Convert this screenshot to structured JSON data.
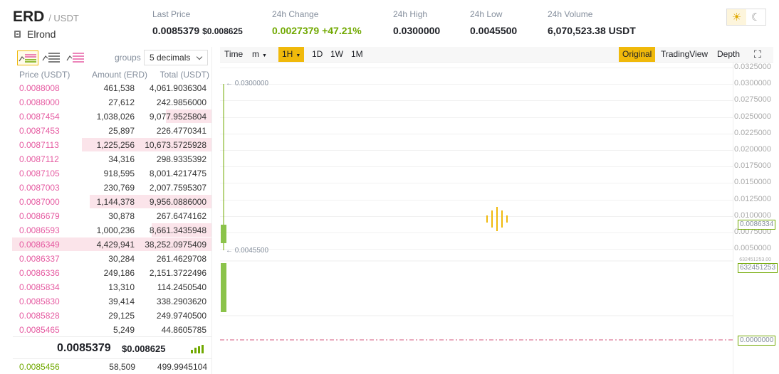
{
  "header": {
    "symbol": "ERD",
    "quote": "/ USDT",
    "coin_name": "Elrond",
    "last_price_label": "Last Price",
    "last_price": "0.0085379",
    "last_price_usd": "$0.008625",
    "change_label": "24h Change",
    "change_value": "0.0027379",
    "change_pct": "+47.21%",
    "high_label": "24h High",
    "high_value": "0.0300000",
    "low_label": "24h Low",
    "low_value": "0.0045500",
    "volume_label": "24h Volume",
    "volume_value": "6,070,523.38 USDT",
    "theme_icons": [
      "sun-icon",
      "moon-icon"
    ]
  },
  "orderbook": {
    "groups_label": "groups",
    "groups_value": "5 decimals",
    "col_price": "Price (USDT)",
    "col_amount": "Amount (ERD)",
    "col_total": "Total (USDT)",
    "asks": [
      {
        "price": "0.0088008",
        "amount": "461,538",
        "total": "4,061.9036304",
        "depth": 0
      },
      {
        "price": "0.0088000",
        "amount": "27,612",
        "total": "242.9856000",
        "depth": 0
      },
      {
        "price": "0.0087454",
        "amount": "1,038,026",
        "total": "9,077.9525804",
        "depth": 0.23
      },
      {
        "price": "0.0087453",
        "amount": "25,897",
        "total": "226.4770341",
        "depth": 0
      },
      {
        "price": "0.0087113",
        "amount": "1,225,256",
        "total": "10,673.5725928",
        "depth": 0.65
      },
      {
        "price": "0.0087112",
        "amount": "34,316",
        "total": "298.9335392",
        "depth": 0
      },
      {
        "price": "0.0087105",
        "amount": "918,595",
        "total": "8,001.4217475",
        "depth": 0
      },
      {
        "price": "0.0087003",
        "amount": "230,769",
        "total": "2,007.7595307",
        "depth": 0
      },
      {
        "price": "0.0087000",
        "amount": "1,144,378",
        "total": "9,956.0886000",
        "depth": 0.61
      },
      {
        "price": "0.0086679",
        "amount": "30,878",
        "total": "267.6474162",
        "depth": 0
      },
      {
        "price": "0.0086593",
        "amount": "1,000,236",
        "total": "8,661.3435948",
        "depth": 0.3
      },
      {
        "price": "0.0086349",
        "amount": "4,429,941",
        "total": "38,252.0975409",
        "depth": 1.0
      },
      {
        "price": "0.0086337",
        "amount": "30,284",
        "total": "261.4629708",
        "depth": 0
      },
      {
        "price": "0.0086336",
        "amount": "249,186",
        "total": "2,151.3722496",
        "depth": 0
      },
      {
        "price": "0.0085834",
        "amount": "13,310",
        "total": "114.2450540",
        "depth": 0
      },
      {
        "price": "0.0085830",
        "amount": "39,414",
        "total": "338.2903620",
        "depth": 0
      },
      {
        "price": "0.0085828",
        "amount": "29,125",
        "total": "249.9740500",
        "depth": 0
      },
      {
        "price": "0.0085465",
        "amount": "5,249",
        "total": "44.8605785",
        "depth": 0
      }
    ],
    "last_price": "0.0085379",
    "last_price_usd": "$0.008625",
    "bids": [
      {
        "price": "0.0085456",
        "amount": "58,509",
        "total": "499.9945104"
      }
    ]
  },
  "chart": {
    "toolbar": [
      "Time",
      "m",
      "1H",
      "1D",
      "1W",
      "1M"
    ],
    "active": "1H",
    "views": [
      "Original",
      "TradingView",
      "Depth"
    ],
    "active_view": "Original",
    "y_labels": [
      "0.0325000",
      "0.0300000",
      "0.0275000",
      "0.0250000",
      "0.0225000",
      "0.0200000",
      "0.0175000",
      "0.0150000",
      "0.0125000",
      "0.0100000",
      "0.0075000",
      "0.0050000"
    ],
    "high_note": "0.0300000",
    "low_note": "0.0045500",
    "price_tag": "0.0086334",
    "volume_tag": "632451253",
    "macd_tag": "0.0000000",
    "small_label": "632451253.00"
  }
}
